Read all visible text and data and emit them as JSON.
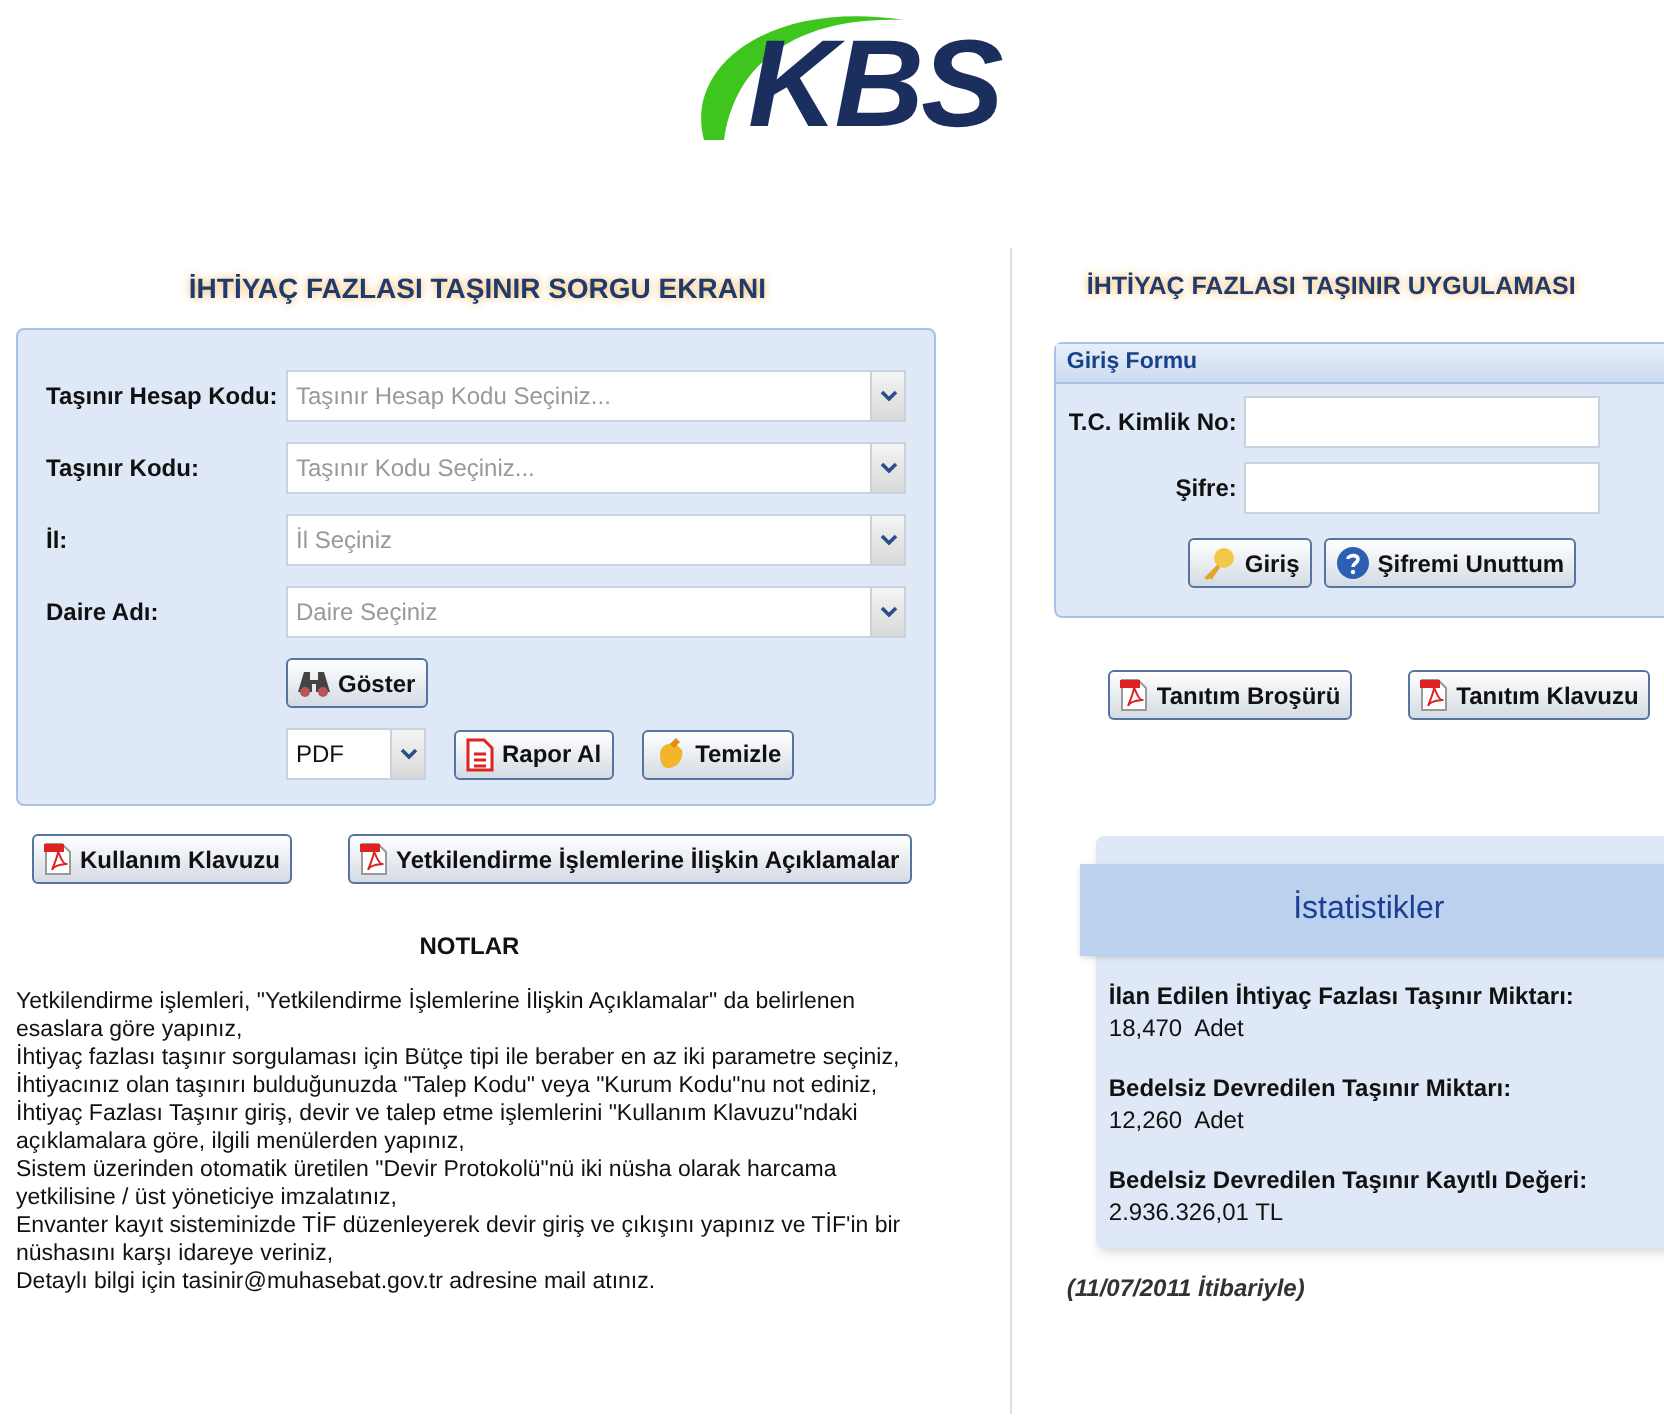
{
  "logo": {
    "text": "KBS"
  },
  "query": {
    "title": "İHTİYAÇ FAZLASI TAŞINIR SORGU EKRANI",
    "fields": [
      {
        "label": "Taşınır Hesap Kodu:",
        "placeholder": "Taşınır Hesap Kodu Seçiniz..."
      },
      {
        "label": "Taşınır Kodu:",
        "placeholder": "Taşınır Kodu Seçiniz..."
      },
      {
        "label": "İl:",
        "placeholder": "İl Seçiniz"
      },
      {
        "label": "Daire Adı:",
        "placeholder": "Daire Seçiniz"
      }
    ],
    "show_button": "Göster",
    "format": "PDF",
    "report_button": "Rapor Al",
    "clear_button": "Temizle"
  },
  "guide_buttons": [
    "Kullanım Klavuzu",
    "Yetkilendirme İşlemlerine İlişkin Açıklamalar"
  ],
  "notes": {
    "title": "NOTLAR",
    "items": [
      "Yetkilendirme işlemleri, \"Yetkilendirme İşlemlerine İlişkin Açıklamalar\" da belirlenen esaslara göre yapınız,",
      "İhtiyaç fazlası taşınır sorgulaması için Bütçe tipi ile beraber en az iki parametre seçiniz,",
      "İhtiyacınız olan taşınırı bulduğunuzda \"Talep Kodu\" veya \"Kurum Kodu\"nu not ediniz,",
      "İhtiyaç Fazlası Taşınır giriş, devir ve talep etme işlemlerini \"Kullanım Klavuzu\"ndaki açıklamalara göre, ilgili menülerden yapınız,",
      "Sistem üzerinden otomatik üretilen \"Devir Protokolü\"nü iki nüsha olarak harcama yetkilisine / üst yöneticiye imzalatınız,",
      "Envanter kayıt sisteminizde TİF düzenleyerek devir giriş ve çıkışını yapınız ve TİF'in bir nüshasını karşı idareye veriniz,",
      "Detaylı bilgi için tasinir@muhasebat.gov.tr adresine mail atınız."
    ]
  },
  "app": {
    "title": "İHTİYAÇ FAZLASI TAŞINIR UYGULAMASI",
    "login": {
      "legend": "Giriş Formu",
      "fields": [
        {
          "label": "T.C. Kimlik No:"
        },
        {
          "label": "Şifre:"
        }
      ],
      "login_button": "Giriş",
      "forgot_button": "Şifremi Unuttum"
    },
    "brochure_buttons": [
      "Tanıtım Broşürü",
      "Tanıtım Klavuzu"
    ],
    "stats": {
      "title": "İstatistikler",
      "items": [
        {
          "label": "İlan Edilen İhtiyaç Fazlası Taşınır Miktarı:",
          "value": "18,470  Adet"
        },
        {
          "label": "Bedelsiz Devredilen Taşınır Miktarı:",
          "value": "12,260  Adet"
        },
        {
          "label": "Bedelsiz Devredilen Taşınır Kayıtlı Değeri:",
          "value": "2.936.326,01 TL"
        }
      ]
    },
    "as_of": "(11/07/2011 İtibariyle)"
  }
}
